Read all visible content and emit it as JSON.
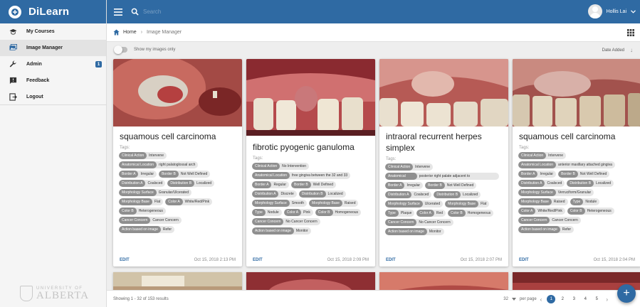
{
  "app": {
    "name": "DiLearn"
  },
  "header": {
    "search_placeholder": "Search",
    "user_name": "Hollis Lai"
  },
  "sidebar": {
    "items": [
      {
        "label": "My Courses",
        "icon": "graduation-cap-icon"
      },
      {
        "label": "Image Manager",
        "icon": "images-icon"
      },
      {
        "label": "Admin",
        "icon": "wrench-icon",
        "badge": "1"
      },
      {
        "label": "Feedback",
        "icon": "feedback-icon"
      },
      {
        "label": "Logout",
        "icon": "logout-icon"
      }
    ],
    "logo_small": "UNIVERSITY OF",
    "logo_big": "ALBERTA"
  },
  "breadcrumb": {
    "home": "Home",
    "current": "Image Manager"
  },
  "toolbar": {
    "toggle_label": "Show my images only",
    "sort_label": "Date Added"
  },
  "tags_label": "Tags:",
  "edit_label": "EDIT",
  "cards": [
    {
      "title": "squamous cell carcinoma",
      "date": "Oct 15, 2018 2:13 PM",
      "tags": [
        [
          [
            "Clinical Action",
            "Intervene"
          ]
        ],
        [
          [
            "Anatomical Location",
            "right palatoglossal arch"
          ]
        ],
        [
          [
            "Border A",
            "Irregular"
          ],
          [
            "Border B",
            "Not Well Defined"
          ]
        ],
        [
          [
            "Distribution A",
            "Coalsced"
          ],
          [
            "Distribution B",
            "Localized"
          ]
        ],
        [
          [
            "Morphology Surface",
            "Granular/Ulcerated"
          ]
        ],
        [
          [
            "Morphology Base",
            "Flat"
          ],
          [
            "Color A",
            "White/Red/Pink"
          ]
        ],
        [
          [
            "Color B",
            "Heterogeneous"
          ]
        ],
        [
          [
            "Cancer Concern",
            "Cancer Concern"
          ]
        ],
        [
          [
            "Action based on image",
            "Refer"
          ]
        ]
      ]
    },
    {
      "title": "fibrotic pyogenic ganuloma",
      "date": "Oct 15, 2018 2:09 PM",
      "tags": [
        [
          [
            "Clinical Action",
            "No Intervention"
          ]
        ],
        [
          [
            "Anatomical Location",
            "free gingiva between the 32 and 33"
          ]
        ],
        [
          [
            "Border A",
            "Regular"
          ],
          [
            "Border B",
            "Well Defined"
          ]
        ],
        [
          [
            "Distribution A",
            "Discrete"
          ],
          [
            "Distribution B",
            "Localized"
          ]
        ],
        [
          [
            "Morphology Surface",
            "Smooth"
          ],
          [
            "Morphology Base",
            "Raised"
          ]
        ],
        [
          [
            "Type",
            "Nodule"
          ],
          [
            "Color A",
            "Pink"
          ],
          [
            "Color B",
            "Homogeneous"
          ]
        ],
        [
          [
            "Cancer Concern",
            "No Cancer Concern"
          ]
        ],
        [
          [
            "Action based on image",
            "Monitor"
          ]
        ]
      ]
    },
    {
      "title": "intraoral recurrent herpes simplex",
      "date": "Oct 15, 2018 2:07 PM",
      "tags": [
        [
          [
            "Clinical Action",
            "Intervene"
          ]
        ],
        [
          [
            "Anatomical",
            "posterior right palate adjacent to"
          ]
        ],
        [
          [
            "Border A",
            "Irregular"
          ],
          [
            "Border B",
            "Not Well Defined"
          ]
        ],
        [
          [
            "Distribution A",
            "Coalsced"
          ],
          [
            "Distribution B",
            "Localized"
          ]
        ],
        [
          [
            "Morphology Surface",
            "Ulcerated"
          ],
          [
            "Morphology Base",
            "Flat"
          ]
        ],
        [
          [
            "Type",
            "Plaque"
          ],
          [
            "Color A",
            "Red"
          ],
          [
            "Color B",
            "Homogeneous"
          ]
        ],
        [
          [
            "Cancer Concern",
            "No Cancer Concern"
          ]
        ],
        [
          [
            "Action based on image",
            "Monitor"
          ]
        ]
      ]
    },
    {
      "title": "squamous cell carcinoma",
      "date": "Oct 15, 2018 2:04 PM",
      "tags": [
        [
          [
            "Clinical Action",
            "Intervene"
          ]
        ],
        [
          [
            "Anatomical Location",
            "anterior maxillary attached gingiva"
          ]
        ],
        [
          [
            "Border A",
            "Irregular"
          ],
          [
            "Border B",
            "Not Well Defined"
          ]
        ],
        [
          [
            "Distribution A",
            "Coalsced"
          ],
          [
            "Distribution B",
            "Localized"
          ]
        ],
        [
          [
            "Morphology Surface",
            "Verruciform/Granular"
          ]
        ],
        [
          [
            "Morphology Base",
            "Raised"
          ],
          [
            "Type",
            "Nodule"
          ]
        ],
        [
          [
            "Color A",
            "White/Red/Pink"
          ],
          [
            "Color B",
            "Heterogeneous"
          ]
        ],
        [
          [
            "Cancer Concern",
            "Cancer Concern"
          ]
        ],
        [
          [
            "Action based on image",
            "Refer"
          ]
        ]
      ]
    }
  ],
  "footer": {
    "showing": "Showing 1 - 32 of 153 results",
    "per_page_value": "32",
    "per_page_label": "per page",
    "pages": [
      "1",
      "2",
      "3",
      "4",
      "5"
    ],
    "current_page": "1"
  },
  "colors": {
    "primary": "#2f6aa3",
    "tag_key": "#8f8f8f",
    "tag_bg": "#e6e6e6"
  }
}
